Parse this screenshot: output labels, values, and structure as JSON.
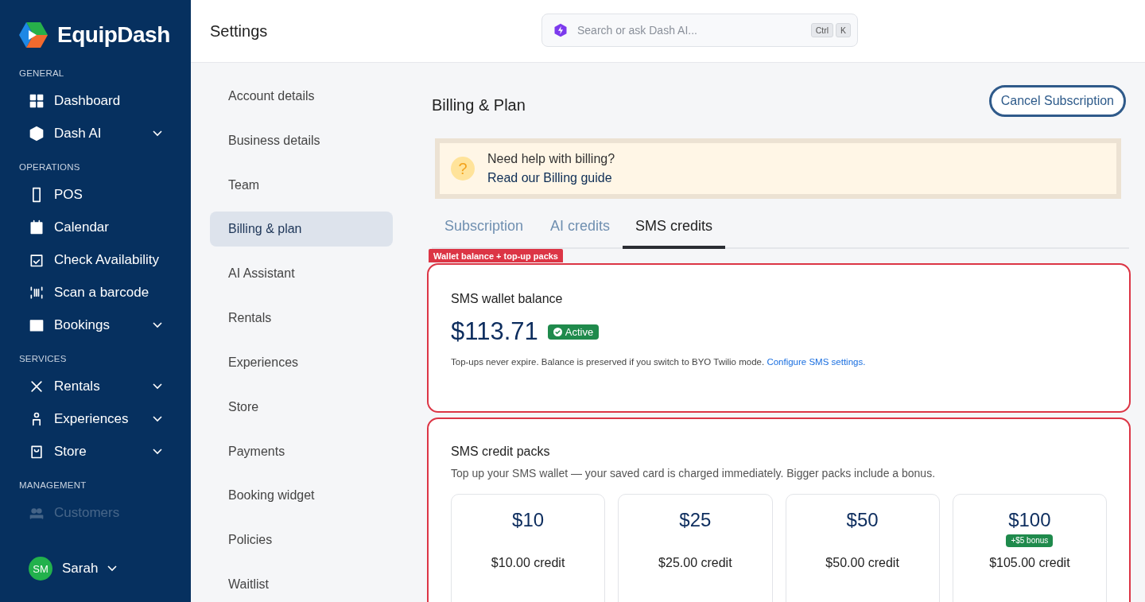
{
  "brand": {
    "name": "EquipDash"
  },
  "sidebar": {
    "sections": [
      {
        "title": "GENERAL",
        "items": [
          {
            "label": "Dashboard",
            "kind": "link"
          },
          {
            "label": "Dash AI",
            "kind": "group"
          }
        ]
      },
      {
        "title": "OPERATIONS",
        "items": [
          {
            "label": "POS",
            "kind": "link"
          },
          {
            "label": "Calendar",
            "kind": "link"
          },
          {
            "label": "Check Availability",
            "kind": "link"
          },
          {
            "label": "Scan a barcode",
            "kind": "link"
          },
          {
            "label": "Bookings",
            "kind": "group"
          }
        ]
      },
      {
        "title": "SERVICES",
        "items": [
          {
            "label": "Rentals",
            "kind": "group"
          },
          {
            "label": "Experiences",
            "kind": "group"
          },
          {
            "label": "Store",
            "kind": "group"
          }
        ]
      },
      {
        "title": "MANAGEMENT",
        "items": [
          {
            "label": "Customers",
            "kind": "faded"
          }
        ]
      }
    ],
    "user": {
      "initials": "SM",
      "name": "Sarah"
    }
  },
  "header": {
    "title": "Settings",
    "search": {
      "placeholder": "Search or ask Dash AI...",
      "keys": [
        "Ctrl",
        "K"
      ]
    }
  },
  "settings_nav": [
    {
      "label": "Account details",
      "selected": false
    },
    {
      "label": "Business details",
      "selected": false
    },
    {
      "label": "Team",
      "selected": false
    },
    {
      "label": "Billing & plan",
      "selected": true
    },
    {
      "label": "AI Assistant",
      "selected": false
    },
    {
      "label": "Rentals",
      "selected": false
    },
    {
      "label": "Experiences",
      "selected": false
    },
    {
      "label": "Store",
      "selected": false
    },
    {
      "label": "Payments",
      "selected": false
    },
    {
      "label": "Booking widget",
      "selected": false
    },
    {
      "label": "Policies",
      "selected": false
    },
    {
      "label": "Waitlist",
      "selected": false
    }
  ],
  "page": {
    "title": "Billing & Plan",
    "action": "Cancel Subscription"
  },
  "help": {
    "title": "Need help with billing?",
    "link": "Read our Billing guide",
    "icon": "?"
  },
  "tabs": [
    {
      "label": "Subscription",
      "selected": false
    },
    {
      "label": "AI credits",
      "selected": false
    },
    {
      "label": "SMS credits",
      "selected": true
    }
  ],
  "annotation": {
    "label": "Wallet balance + top-up packs"
  },
  "wallet": {
    "title": "SMS wallet balance",
    "balance": "$113.71",
    "status": "Active",
    "note": "Top-ups never expire. Balance is preserved if you switch to BYO Twilio mode.",
    "link": "Configure SMS settings."
  },
  "packs": {
    "title": "SMS credit packs",
    "subtitle": "Top up your SMS wallet — your saved card is charged immediately. Bigger packs include a bonus.",
    "items": [
      {
        "price": "$10",
        "credit": "$10.00 credit"
      },
      {
        "price": "$25",
        "credit": "$25.00 credit"
      },
      {
        "price": "$50",
        "credit": "$50.00 credit"
      },
      {
        "price": "$100",
        "bonus": "+$5 bonus",
        "credit": "$105.00 credit"
      }
    ]
  }
}
